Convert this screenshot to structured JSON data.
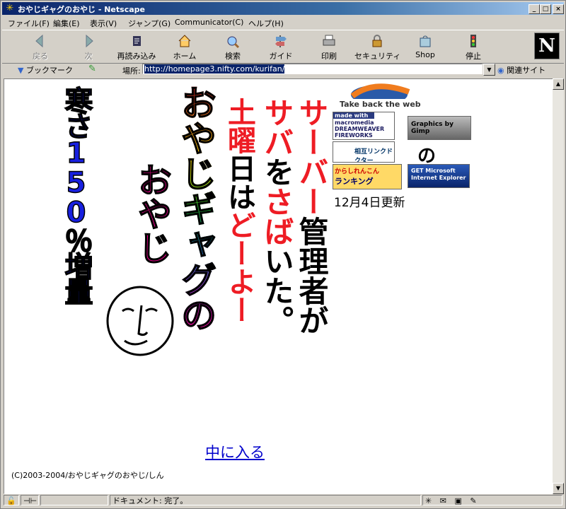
{
  "window": {
    "title": "おやじギャグのおやじ - Netscape",
    "buttons": {
      "minimize": "_",
      "maximize": "□",
      "close": "×"
    }
  },
  "menu": [
    "ファイル(F)",
    "編集(E)",
    "表示(V)",
    "ジャンプ(G)",
    "Communicator(C)",
    "ヘルプ(H)"
  ],
  "toolbar": {
    "back": "戻る",
    "forward": "次",
    "reload": "再読み込み",
    "home": "ホーム",
    "search": "検索",
    "guide": "ガイド",
    "print": "印刷",
    "security": "セキュリティ",
    "shop": "Shop",
    "stop": "停止",
    "logo": "N"
  },
  "location": {
    "bookmarks_label": "ブックマーク",
    "field_label": "場所:",
    "url": "http://homepage3.nifty.com/kurifan/",
    "related_label": "関連サイト"
  },
  "page": {
    "col_blue": "寒さ150％増量",
    "col_rainbow_1": "おやじギャグの",
    "col_rainbow_2": "おやじ",
    "col_red_1_red": "土曜",
    "col_red_1_black": "日は",
    "col_red_1_red2": "どーよー",
    "col_red_2_red": "サーバー",
    "col_red_3_red": "サバ",
    "col_red_3_black": "を",
    "col_red_3_red2": "さば",
    "col_red_3_black2": "いた。",
    "col_red_2_black": "管理者が",
    "firefox_text": "Take back the web",
    "badge_macromedia_top": "made with",
    "badge_macromedia": "macromedia DREAMWEAVER FIREWORKS STUDIO",
    "badge_gimp": "Graphics by Gimp",
    "badge_link": "相互リンクドクター",
    "badge_no": "の",
    "badge_ranking_top": "からしれんこん",
    "badge_ranking": "ランキング",
    "badge_ie": "GET Microsoft Internet Explorer",
    "updated": "12月4日更新",
    "enter_link": "中に入る",
    "copyright": "(C)2003-2004/おやじギャグのおやじ/しん"
  },
  "status": {
    "text": "ドキュメント: 完了。"
  },
  "colors": {
    "title_bar": "#0a246a",
    "blue_text": "#1820e0",
    "red_text": "#ee1c24",
    "link": "#0000cc"
  }
}
